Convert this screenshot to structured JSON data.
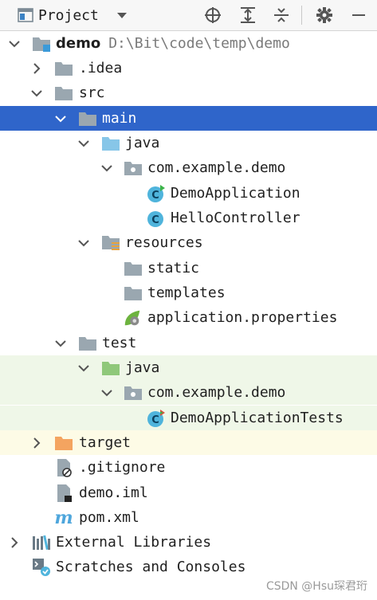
{
  "toolbar": {
    "title": "Project"
  },
  "tree": {
    "root_name": "demo",
    "root_path": "D:\\Bit\\code\\temp\\demo",
    "idea": ".idea",
    "src": "src",
    "main": "main",
    "main_java": "java",
    "main_package": "com.example.demo",
    "demo_application": "DemoApplication",
    "hello_controller": "HelloController",
    "resources": "resources",
    "static": "static",
    "templates": "templates",
    "app_properties": "application.properties",
    "test": "test",
    "test_java": "java",
    "test_package": "com.example.demo",
    "demo_application_tests": "DemoApplicationTests",
    "target": "target",
    "gitignore": ".gitignore",
    "demo_iml": "demo.iml",
    "pom": "pom.xml",
    "external_libraries": "External Libraries",
    "scratches": "Scratches and Consoles"
  },
  "watermark": "CSDN @Hsu琛君珩",
  "colors": {
    "selection": "#2f65ca",
    "folder_gray": "#9aa7b0",
    "source_folder": "#87c6e8",
    "test_folder": "#8fc87a",
    "excluded_folder": "#f4a460",
    "class_circle": "#4fb4dc"
  }
}
